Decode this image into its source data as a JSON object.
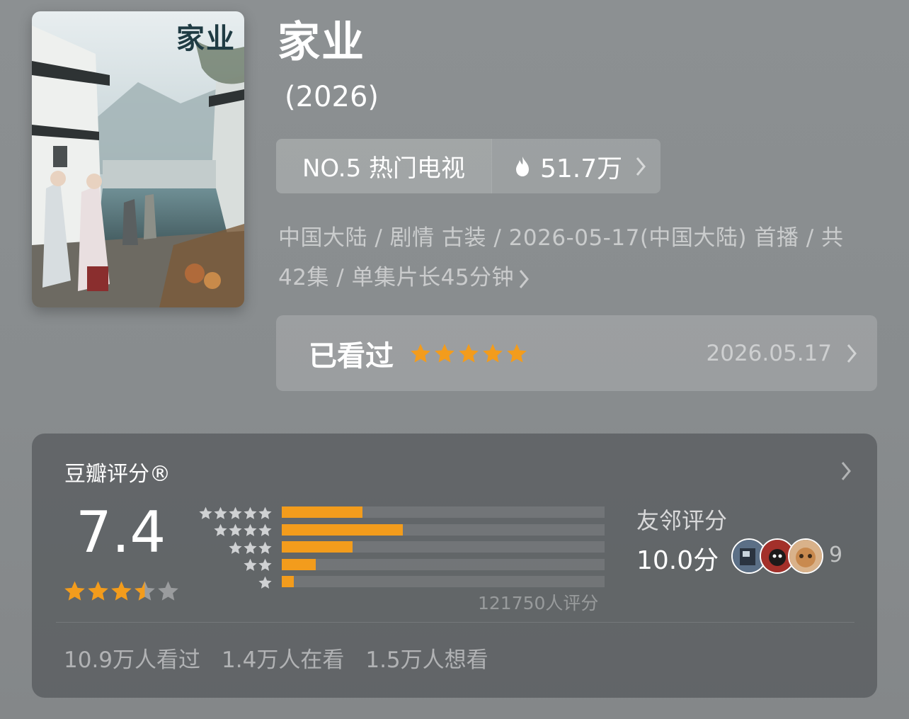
{
  "poster": {
    "title_text": "家业",
    "icon": "poster-image"
  },
  "header": {
    "title": "家业",
    "year": "(2026)"
  },
  "rank": {
    "label": "NO.5 热门电视",
    "heat": "51.7万",
    "flame_icon": "flame-icon"
  },
  "info": {
    "text": "中国大陆 / 剧情 古装 / 2026-05-17(中国大陆) 首播 / 共 42集 / 单集片长45分钟"
  },
  "watched": {
    "label": "已看过",
    "stars": 5,
    "date": "2026.05.17",
    "star_color": "#f39c1c"
  },
  "rating": {
    "title": "豆瓣评分®",
    "score": "7.4",
    "stars": 3.5,
    "distribution": [
      {
        "stars": 5,
        "fraction": 0.25
      },
      {
        "stars": 4,
        "fraction": 0.375
      },
      {
        "stars": 3,
        "fraction": 0.22
      },
      {
        "stars": 2,
        "fraction": 0.105
      },
      {
        "stars": 1,
        "fraction": 0.038
      }
    ],
    "count": "121750人评分",
    "friends_label": "友邻评分",
    "friends_score": "10.0分",
    "friends_count": "9",
    "bar_color": "#f39c1c"
  },
  "stats": {
    "watched": "10.9万人看过",
    "watching": "1.4万人在看",
    "want": "1.5万人想看"
  }
}
